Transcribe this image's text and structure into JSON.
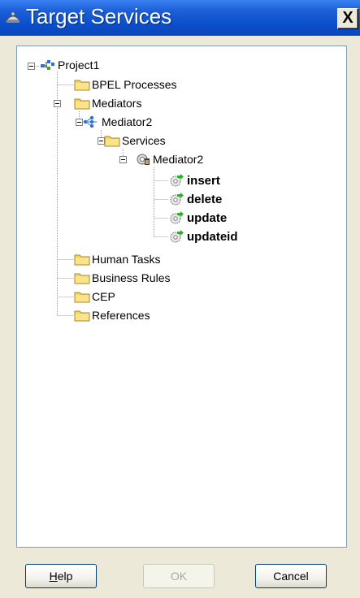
{
  "window": {
    "title": "Target Services",
    "close_label": "X"
  },
  "tree": {
    "project": "Project1",
    "bpel": "BPEL Processes",
    "mediators": "Mediators",
    "mediator2": "Mediator2",
    "services": "Services",
    "service_mediator2": "Mediator2",
    "ops": [
      "insert",
      "delete",
      "update",
      "updateid"
    ],
    "human_tasks": "Human Tasks",
    "business_rules": "Business Rules",
    "cep": "CEP",
    "references": "References"
  },
  "buttons": {
    "help": "Help",
    "ok": "OK",
    "cancel": "Cancel"
  },
  "colors": {
    "title_bar": "#0b4ecc",
    "folder": "#f6d35a",
    "op_arrow": "#2cb02c"
  }
}
